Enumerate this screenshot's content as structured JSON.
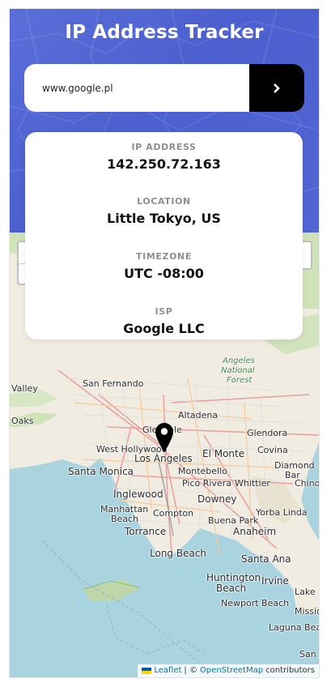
{
  "app": {
    "title": "IP Address Tracker"
  },
  "search": {
    "value": "www.google.pl",
    "submit_icon": "chevron-right-icon"
  },
  "info": {
    "ip_label": "IP ADDRESS",
    "ip_value": "142.250.72.163",
    "location_label": "LOCATION",
    "location_value": "Little Tokyo, US",
    "timezone_label": "TIMEZONE",
    "timezone_value": "UTC -08:00",
    "isp_label": "ISP",
    "isp_value": "Google LLC"
  },
  "map": {
    "zoom_in": "+",
    "zoom_out": "−",
    "places": {
      "valley": "Valley",
      "san_fernando": "San Fernando",
      "angeles": "Angeles",
      "national": "National",
      "forest": "Forest",
      "oaks": "Oaks",
      "altadena": "Altadena",
      "glendale": "Glendale",
      "glendora": "Glendora",
      "west_hollywood": "West Hollywood",
      "los_angeles": "Los Angeles",
      "el_monte": "El Monte",
      "covina": "Covina",
      "santa_monica": "Santa Monica",
      "montebello": "Montebello",
      "diamond": "Diamond",
      "bar": "Bar",
      "pico_rivera": "Pico Rivera",
      "chino": "Chino",
      "inglewood": "Inglewood",
      "whittier": "Whittier",
      "downey": "Downey",
      "manhattan": "Manhattan",
      "beach1": "Beach",
      "compton": "Compton",
      "buena_park": "Buena Park",
      "yorba_linda": "Yorba Linda",
      "torrance": "Torrance",
      "anaheim": "Anaheim",
      "long_beach": "Long Beach",
      "santa_ana": "Santa Ana",
      "huntington": "Huntington",
      "beach2": "Beach",
      "irvine": "Irvine",
      "newport_beach": "Newport Beach",
      "lake_fo": "Lake Fo",
      "missio": "Missio",
      "laguna_beach": "Laguna Beach",
      "san": "San"
    },
    "attribution": {
      "leaflet": "Leaflet",
      "separator": "| ©",
      "osm": "OpenStreetMap",
      "contributors": "contributors"
    }
  },
  "colors": {
    "header_gradient_start": "#5a6fd8",
    "header_gradient_end": "#4b5fd0",
    "water": "#a9d3df",
    "land": "#f0ece2",
    "forest": "#cfe2b8",
    "marker": "#000000",
    "link": "#0078a8"
  }
}
